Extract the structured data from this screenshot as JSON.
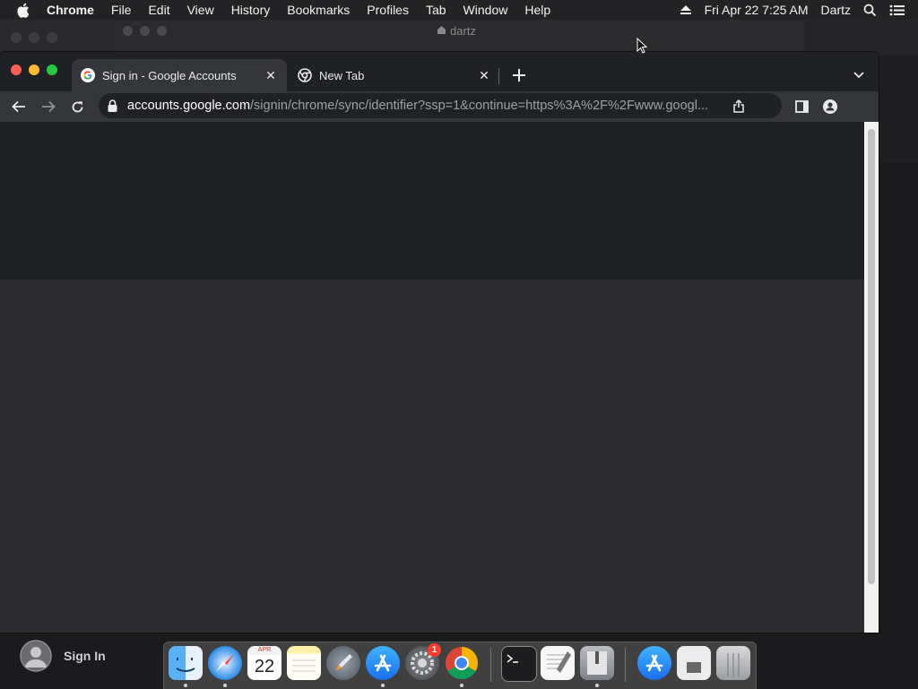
{
  "menubar": {
    "app_name": "Chrome",
    "items": [
      "File",
      "Edit",
      "View",
      "History",
      "Bookmarks",
      "Profiles",
      "Tab",
      "Window",
      "Help"
    ],
    "clock": "Fri Apr 22  7:25 AM",
    "user": "Dartz"
  },
  "background_window": {
    "title": "dartz"
  },
  "chrome": {
    "tabs": [
      {
        "label": "Sign in - Google Accounts",
        "active": true,
        "icon": "google-g-icon"
      },
      {
        "label": "New Tab",
        "active": false,
        "icon": "chrome-icon"
      }
    ],
    "omnibox": {
      "host": "accounts.google.com",
      "path": "/signin/chrome/sync/identifier?ssp=1&continue=https%3A%2F%2Fwww.googl..."
    }
  },
  "login_panel": {
    "label": "Sign In"
  },
  "dock": {
    "calendar_month": "APR",
    "calendar_day": "22",
    "settings_badge": "1",
    "apps": [
      "Finder",
      "Safari",
      "Calendar",
      "Notes",
      "Launchpad",
      "App Store",
      "System Preferences",
      "Google Chrome",
      "Terminal",
      "TextEdit",
      "Archive Utility",
      "App Store",
      "Preview",
      "Trash"
    ]
  },
  "colors": {
    "menubar_bg": "#232325",
    "tabstrip_bg": "#202124",
    "active_tab_bg": "#35363a",
    "page_top_band": "#1f2024",
    "page_bg": "#2b2b2d",
    "traffic_red": "#ff5f57",
    "traffic_yellow": "#febc2e",
    "traffic_green": "#28c840"
  }
}
